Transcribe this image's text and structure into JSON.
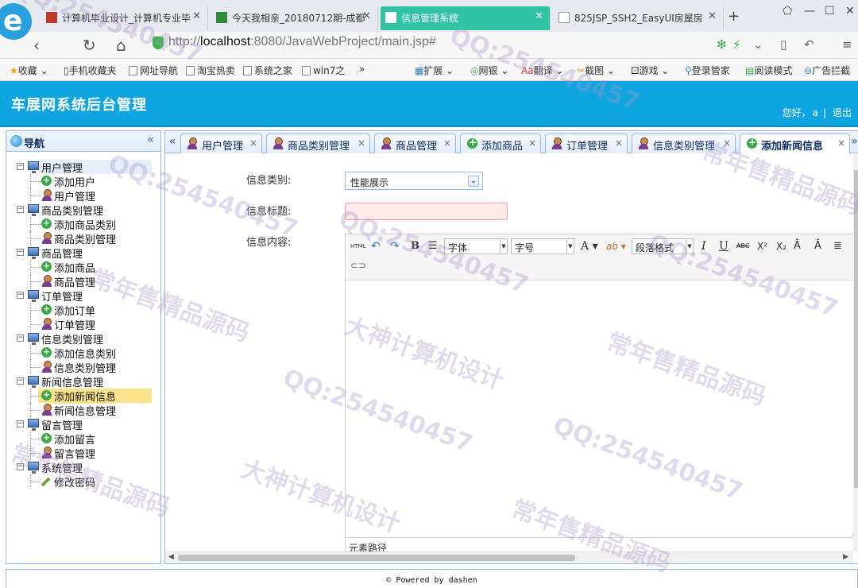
{
  "browser": {
    "tabs": [
      {
        "label": "计算机毕业设计_计算机专业毕",
        "favicon_color": "#c0392b"
      },
      {
        "label": "今天我相亲_20180712期-成都",
        "favicon_color": "#2e8b3e"
      },
      {
        "label": "信息管理系统",
        "favicon_color": "#ffffff"
      },
      {
        "label": "825JSP_SSH2_EasyUI房屋房",
        "favicon_color": "#ffffff"
      }
    ],
    "url_prefix": "http://",
    "url_host": "localhost",
    "url_rest": ":8080/JavaWebProject/main.jsp#"
  },
  "bookmarks": [
    "收藏",
    "手机收藏夹",
    "网址导航",
    "淘宝热卖",
    "系统之家",
    "win7之",
    "»",
    "扩展",
    "网银",
    "翻译",
    "截图",
    "游戏",
    "登录管家",
    "阅读模式",
    "广告拦截"
  ],
  "header": {
    "title": "车展网系统后台管理",
    "greeting": "您好，",
    "username": "a",
    "separator": "|",
    "logout": "退出"
  },
  "nav": {
    "title": "导航",
    "collapse_icon": "«",
    "groups": [
      {
        "label": "用户管理",
        "items": [
          {
            "label": "添加用户",
            "icon": "add-icon"
          },
          {
            "label": "用户管理",
            "icon": "user-icon"
          }
        ]
      },
      {
        "label": "商品类别管理",
        "items": [
          {
            "label": "添加商品类别",
            "icon": "add-icon"
          },
          {
            "label": "商品类别管理",
            "icon": "user-icon"
          }
        ]
      },
      {
        "label": "商品管理",
        "items": [
          {
            "label": "添加商品",
            "icon": "add-icon"
          },
          {
            "label": "商品管理",
            "icon": "user-icon"
          }
        ]
      },
      {
        "label": "订单管理",
        "items": [
          {
            "label": "添加订单",
            "icon": "add-icon"
          },
          {
            "label": "订单管理",
            "icon": "user-icon"
          }
        ]
      },
      {
        "label": "信息类别管理",
        "items": [
          {
            "label": "添加信息类别",
            "icon": "add-icon"
          },
          {
            "label": "信息类别管理",
            "icon": "user-icon"
          }
        ]
      },
      {
        "label": "新闻信息管理",
        "items": [
          {
            "label": "添加新闻信息",
            "icon": "add-icon",
            "selected": true
          },
          {
            "label": "新闻信息管理",
            "icon": "user-icon"
          }
        ]
      },
      {
        "label": "留言管理",
        "items": [
          {
            "label": "添加留言",
            "icon": "add-icon"
          },
          {
            "label": "留言管理",
            "icon": "user-icon"
          }
        ]
      },
      {
        "label": "系统管理",
        "items": [
          {
            "label": "修改密码",
            "icon": "pencil-icon"
          }
        ]
      }
    ]
  },
  "content_tabs": [
    {
      "label": "用户管理",
      "icon": "user-icon"
    },
    {
      "label": "商品类别管理",
      "icon": "user-icon"
    },
    {
      "label": "商品管理",
      "icon": "user-icon"
    },
    {
      "label": "添加商品",
      "icon": "add-icon"
    },
    {
      "label": "订单管理",
      "icon": "user-icon"
    },
    {
      "label": "信息类别管理",
      "icon": "user-icon"
    },
    {
      "label": "添加新闻信息",
      "icon": "add-icon",
      "active": true
    }
  ],
  "tab_close": "×",
  "form": {
    "category_label": "信息类别:",
    "category_value": "性能展示",
    "title_label": "信息标题:",
    "title_value": "",
    "content_label": "信息内容:"
  },
  "editor": {
    "html_btn": "HTML",
    "bold": "B",
    "font_family": "字体",
    "font_size": "字号",
    "font_color": "A",
    "highlight": "ab",
    "paragraph": "段落格式",
    "italic": "I",
    "underline": "U",
    "strike": "ABC",
    "superscript": "X²",
    "subscript": "X₂",
    "status": "元素路径"
  },
  "footer": "© Powered by dashen",
  "watermarks": [
    "QQ:254540457",
    "大神计算机设计",
    "常年售精品源码"
  ],
  "colors": {
    "header_bg": "#0ea5e0",
    "active_browser_tab": "#31c3a6",
    "panel_border": "#95b8e7",
    "selected_nav": "#fbe38b"
  }
}
